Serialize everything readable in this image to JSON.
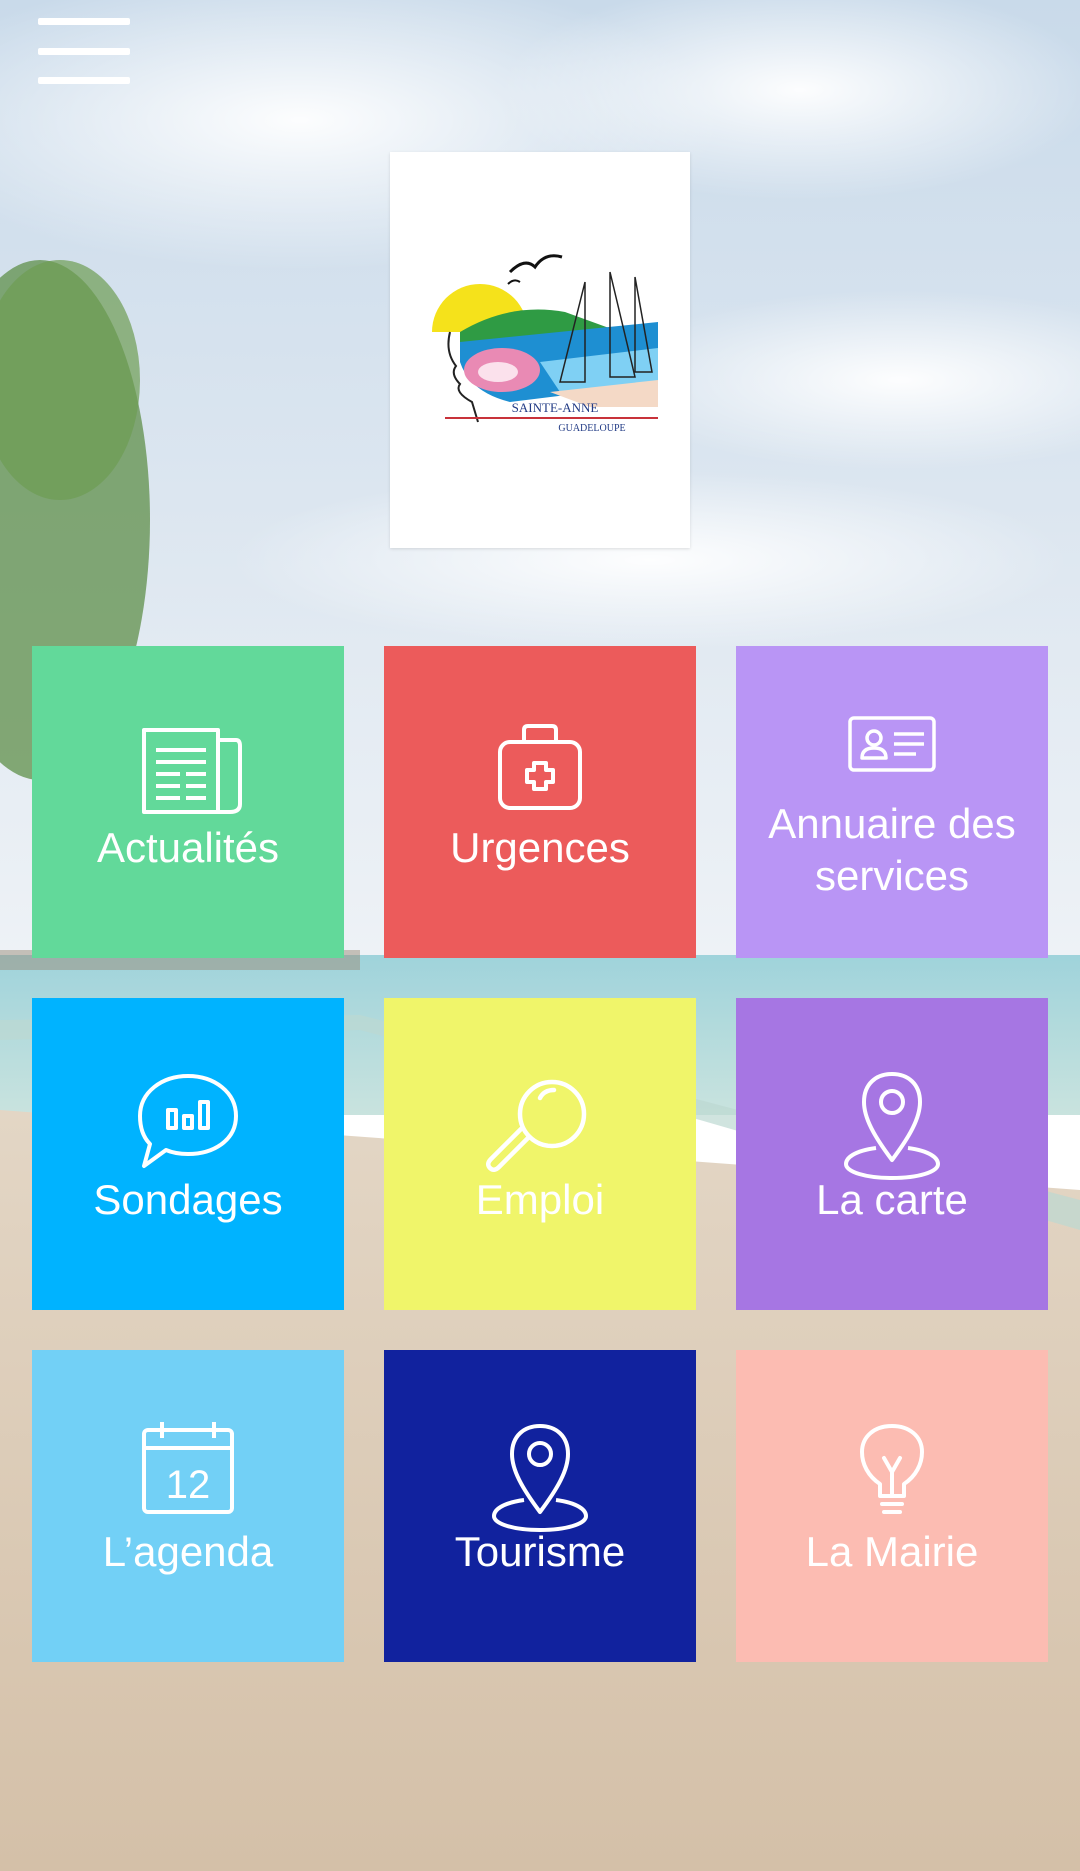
{
  "header": {
    "menu_icon": "hamburger-menu-icon"
  },
  "logo": {
    "line1": "SAINTE-ANNE",
    "line2": "GUADELOUPE"
  },
  "tiles": [
    {
      "label": "Actualités",
      "icon": "newspaper-icon",
      "color": "#62d99a"
    },
    {
      "label": "Urgences",
      "icon": "first-aid-kit-icon",
      "color": "#ec5b5b"
    },
    {
      "label": "Annuaire des\nservices",
      "label_line1": "Annuaire des",
      "label_line2": "services",
      "icon": "contact-card-icon",
      "color": "#b995f5"
    },
    {
      "label": "Sondages",
      "icon": "poll-chat-icon",
      "color": "#00b3ff"
    },
    {
      "label": "Emploi",
      "icon": "magnifier-icon",
      "color": "#f0f56a"
    },
    {
      "label": "La carte",
      "icon": "map-pin-icon",
      "color": "#a676e3"
    },
    {
      "label": "L’agenda",
      "icon": "calendar-icon",
      "calendar_day": "12",
      "color": "#72d0f6"
    },
    {
      "label": "Tourisme",
      "icon": "location-pin-icon",
      "color": "#11229e"
    },
    {
      "label": "La Mairie",
      "icon": "lightbulb-icon",
      "color": "#fcbcb2"
    }
  ]
}
